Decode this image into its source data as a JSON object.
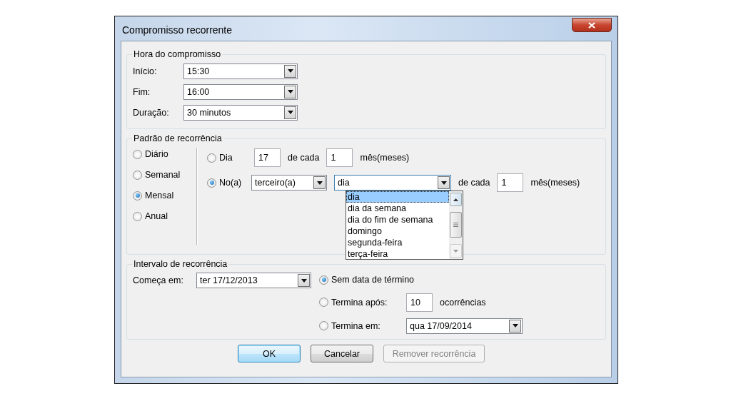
{
  "window": {
    "title": "Compromisso recorrente"
  },
  "appointment_time": {
    "title": "Hora do compromisso",
    "fields": [
      {
        "label": "Início:",
        "value": "15:30"
      },
      {
        "label": "Fim:",
        "value": "16:00"
      },
      {
        "label": "Duração:",
        "value": "30 minutos"
      }
    ]
  },
  "recurrence_pattern": {
    "title": "Padrão de recorrência",
    "frequencies": [
      {
        "label": "Diário",
        "selected": false
      },
      {
        "label": "Semanal",
        "selected": false
      },
      {
        "label": "Mensal",
        "selected": true
      },
      {
        "label": "Anual",
        "selected": false
      }
    ],
    "day_option": {
      "label": "Dia",
      "selected": false,
      "day": "17",
      "every_label": "de cada",
      "months": "1",
      "unit": "mês(meses)"
    },
    "ordinal_option": {
      "label": "No(a)",
      "selected": true,
      "ordinal": "terceiro(a)",
      "weekday": "dia",
      "every_label": "de cada",
      "months": "1",
      "unit": "mês(meses)",
      "dropdown_items": [
        {
          "label": "dia",
          "selected": true
        },
        {
          "label": "dia da semana",
          "selected": false
        },
        {
          "label": "dia do fim de semana",
          "selected": false
        },
        {
          "label": "domingo",
          "selected": false
        },
        {
          "label": "segunda-feira",
          "selected": false
        },
        {
          "label": "terça-feira",
          "selected": false
        }
      ]
    }
  },
  "recurrence_range": {
    "title": "Intervalo de recorrência",
    "start_label": "Começa em:",
    "start_value": "ter 17/12/2013",
    "end_options": [
      {
        "kind": "none",
        "label": "Sem data de término",
        "selected": true
      },
      {
        "kind": "after",
        "label": "Termina após:",
        "selected": false,
        "value": "10",
        "suffix": "ocorrências"
      },
      {
        "kind": "date",
        "label": "Termina em:",
        "selected": false,
        "value": "qua 17/09/2014"
      }
    ]
  },
  "buttons": [
    {
      "label": "OK",
      "default": true,
      "disabled": false
    },
    {
      "label": "Cancelar",
      "default": false,
      "disabled": false
    },
    {
      "label": "Remover recorrência",
      "default": false,
      "disabled": true
    }
  ]
}
